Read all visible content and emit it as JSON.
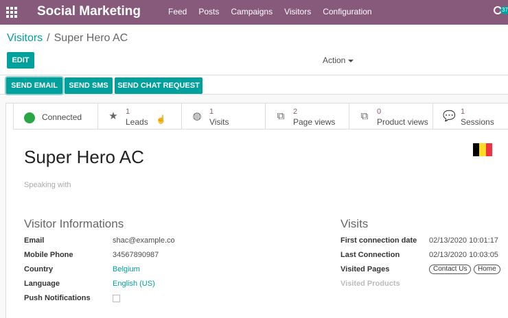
{
  "navbar": {
    "brand": "Social Marketing",
    "menu": [
      "Feed",
      "Posts",
      "Campaigns",
      "Visitors",
      "Configuration"
    ],
    "activity_badge": "37"
  },
  "breadcrumb": {
    "parent": "Visitors",
    "separator": "/",
    "current": "Super Hero AC"
  },
  "buttons": {
    "edit": "EDIT",
    "action": "Action",
    "send_email": "SEND EMAIL",
    "send_sms": "SEND SMS",
    "send_chat": "SEND CHAT REQUEST"
  },
  "stats": {
    "status": "Connected",
    "leads": {
      "value": "1",
      "label": "Leads"
    },
    "visits": {
      "value": "1",
      "label": "Visits"
    },
    "page_views": {
      "value": "2",
      "label": "Page views"
    },
    "product_views": {
      "value": "0",
      "label": "Product views"
    },
    "sessions": {
      "value": "1",
      "label": "Sessions"
    }
  },
  "visitor": {
    "name": "Super Hero AC",
    "speaking_with": "Speaking with",
    "flag_colors": [
      "#000000",
      "#fdda24",
      "#ef3340"
    ]
  },
  "visitor_info": {
    "title": "Visitor Informations",
    "email_label": "Email",
    "email": "shac@example.co",
    "phone_label": "Mobile Phone",
    "phone": "34567890987",
    "country_label": "Country",
    "country": "Belgium",
    "language_label": "Language",
    "language": "English (US)",
    "push_label": "Push Notifications"
  },
  "visits": {
    "title": "Visits",
    "first_label": "First connection date",
    "first": "02/13/2020 10:01:17",
    "last_label": "Last Connection",
    "last": "02/13/2020 10:03:05",
    "pages_label": "Visited Pages",
    "pages": [
      "Contact Us",
      "Home"
    ],
    "products_label": "Visited Products"
  },
  "colors": {
    "brand": "#875a7b",
    "accent": "#00a09d",
    "status": "#28a745"
  }
}
